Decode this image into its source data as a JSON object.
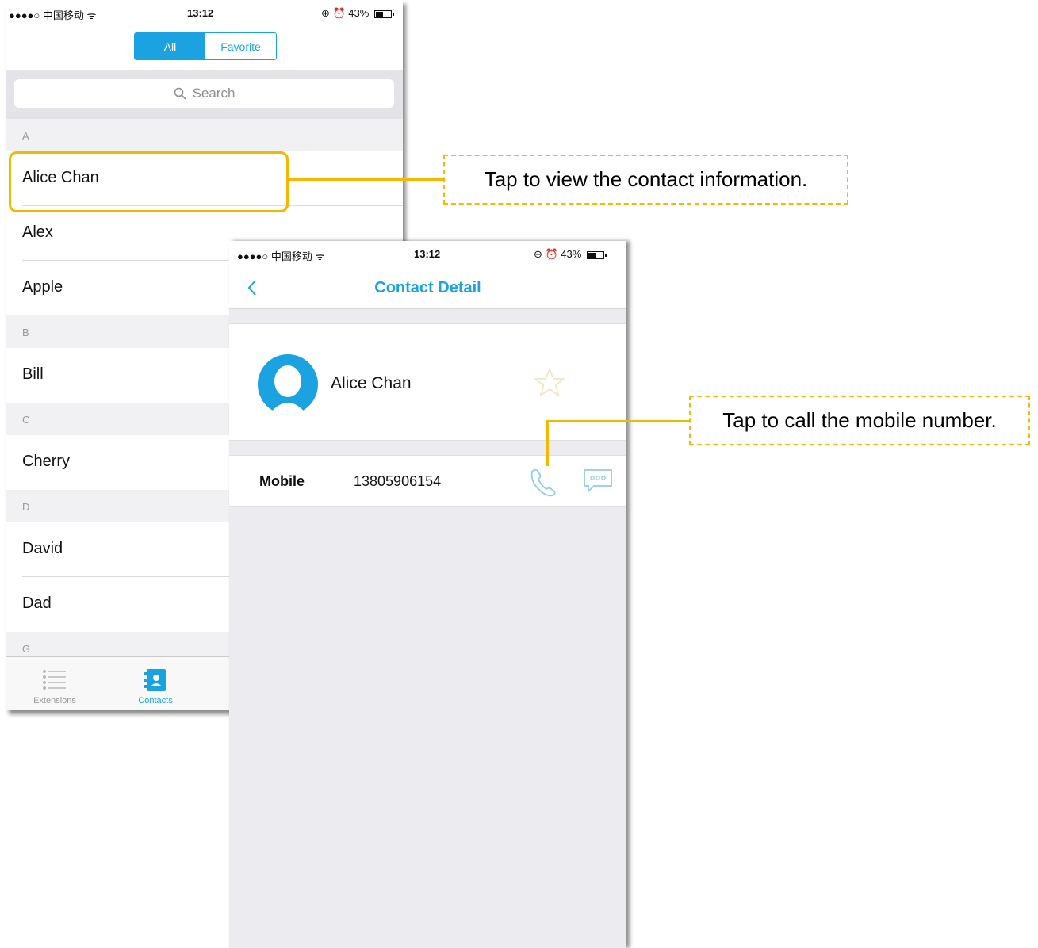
{
  "list_screen": {
    "status": {
      "carrier": "●●●●○ 中国移动 ᯤ",
      "time": "13:12",
      "right": "⊕ ⏰ 43%"
    },
    "segment": {
      "all": "All",
      "favorite": "Favorite"
    },
    "search": {
      "placeholder": "Search"
    },
    "sections": {
      "a": {
        "letter": "A",
        "items": [
          "Alice Chan",
          "Alex",
          "Apple"
        ]
      },
      "b": {
        "letter": "B",
        "items": [
          "Bill"
        ]
      },
      "c": {
        "letter": "C",
        "items": [
          "Cherry"
        ]
      },
      "d": {
        "letter": "D",
        "items": [
          "David",
          "Dad"
        ]
      },
      "g": {
        "letter": "G"
      }
    },
    "tabs": {
      "extensions": "Extensions",
      "contacts": "Contacts"
    }
  },
  "detail_screen": {
    "status": {
      "carrier": "●●●●○ 中国移动 ᯤ",
      "time": "13:12",
      "right": "⊕ ⏰ 43%"
    },
    "title": "Contact Detail",
    "name": "Alice Chan",
    "mobile_label": "Mobile",
    "mobile_number": "13805906154"
  },
  "callouts": {
    "view_info": "Tap to view the contact information.",
    "call_mobile": "Tap to call the mobile number."
  },
  "colors": {
    "accent": "#1aa3e0",
    "highlight": "#f5b800"
  }
}
